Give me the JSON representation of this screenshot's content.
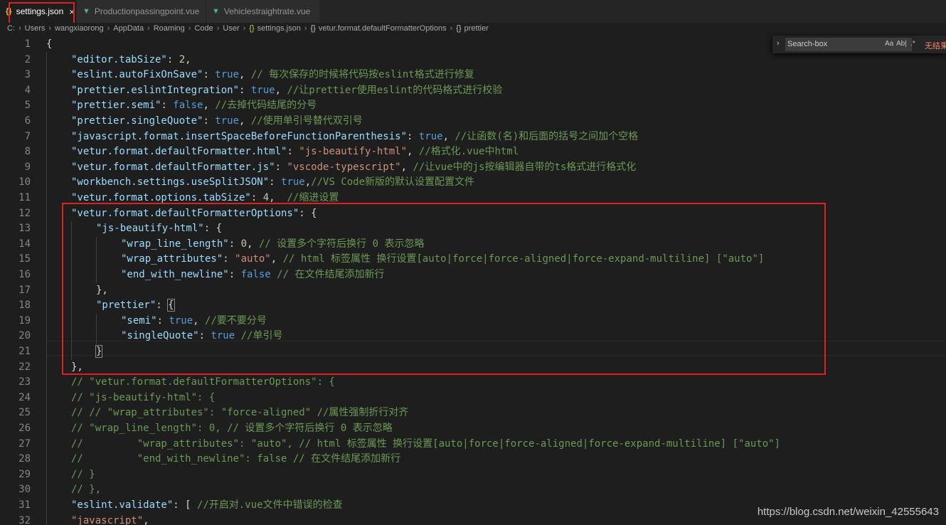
{
  "tabs": [
    {
      "label": "settings.json",
      "icon": "{}",
      "active": true,
      "close": "×"
    },
    {
      "label": "Productionpassingpoint.vue",
      "icon": "▼",
      "active": false
    },
    {
      "label": "Vehiclestraightrate.vue",
      "icon": "▼",
      "active": false
    }
  ],
  "breadcrumb": [
    "C:",
    "Users",
    "wangxiaorong",
    "AppData",
    "Roaming",
    "Code",
    "User",
    "settings.json",
    "vetur.format.defaultFormatterOptions",
    "prettier"
  ],
  "find_widget": {
    "value": "Search-box",
    "match_case": "Aa",
    "whole_word": "Ab|",
    "regex": ".*",
    "no_results": "无结果"
  },
  "watermark": "https://blog.csdn.net/weixin_42555643",
  "lines": [
    {
      "n": "1",
      "indent": 0,
      "tokens": [
        [
          "p",
          "{"
        ]
      ]
    },
    {
      "n": "2",
      "indent": 1,
      "tokens": [
        [
          "k",
          "\"editor.tabSize\""
        ],
        [
          "p",
          ": "
        ],
        [
          "n",
          "2"
        ],
        [
          "p",
          ","
        ]
      ]
    },
    {
      "n": "3",
      "indent": 1,
      "tokens": [
        [
          "k",
          "\"eslint.autoFixOnSave\""
        ],
        [
          "p",
          ": "
        ],
        [
          "w",
          "true"
        ],
        [
          "p",
          ", "
        ],
        [
          "c",
          "// 每次保存的时候将代码按eslint格式进行修复"
        ]
      ]
    },
    {
      "n": "4",
      "indent": 1,
      "tokens": [
        [
          "k",
          "\"prettier.eslintIntegration\""
        ],
        [
          "p",
          ": "
        ],
        [
          "w",
          "true"
        ],
        [
          "p",
          ", "
        ],
        [
          "c",
          "//让prettier使用eslint的代码格式进行校验"
        ]
      ]
    },
    {
      "n": "5",
      "indent": 1,
      "tokens": [
        [
          "k",
          "\"prettier.semi\""
        ],
        [
          "p",
          ": "
        ],
        [
          "w",
          "false"
        ],
        [
          "p",
          ", "
        ],
        [
          "c",
          "//去掉代码结尾的分号"
        ]
      ]
    },
    {
      "n": "6",
      "indent": 1,
      "tokens": [
        [
          "k",
          "\"prettier.singleQuote\""
        ],
        [
          "p",
          ": "
        ],
        [
          "w",
          "true"
        ],
        [
          "p",
          ", "
        ],
        [
          "c",
          "//使用单引号替代双引号"
        ]
      ]
    },
    {
      "n": "7",
      "indent": 1,
      "tokens": [
        [
          "k",
          "\"javascript.format.insertSpaceBeforeFunctionParenthesis\""
        ],
        [
          "p",
          ": "
        ],
        [
          "w",
          "true"
        ],
        [
          "p",
          ", "
        ],
        [
          "c",
          "//让函数(名)和后面的括号之间加个空格"
        ]
      ]
    },
    {
      "n": "8",
      "indent": 1,
      "tokens": [
        [
          "k",
          "\"vetur.format.defaultFormatter.html\""
        ],
        [
          "p",
          ": "
        ],
        [
          "s",
          "\"js-beautify-html\""
        ],
        [
          "p",
          ", "
        ],
        [
          "c",
          "//格式化.vue中html"
        ]
      ]
    },
    {
      "n": "9",
      "indent": 1,
      "tokens": [
        [
          "k",
          "\"vetur.format.defaultFormatter.js\""
        ],
        [
          "p",
          ": "
        ],
        [
          "s",
          "\"vscode-typescript\""
        ],
        [
          "p",
          ", "
        ],
        [
          "c",
          "//让vue中的js按编辑器自带的ts格式进行格式化"
        ]
      ]
    },
    {
      "n": "10",
      "indent": 1,
      "tokens": [
        [
          "k",
          "\"workbench.settings.useSplitJSON\""
        ],
        [
          "p",
          ": "
        ],
        [
          "w",
          "true"
        ],
        [
          "p",
          ","
        ],
        [
          "c",
          "//VS Code新版的默认设置配置文件"
        ]
      ]
    },
    {
      "n": "11",
      "indent": 1,
      "tokens": [
        [
          "k",
          "\"vetur.format.options.tabSize\""
        ],
        [
          "p",
          ": "
        ],
        [
          "n",
          "4"
        ],
        [
          "p",
          ",  "
        ],
        [
          "c",
          "//缩进设置"
        ]
      ]
    },
    {
      "n": "12",
      "indent": 1,
      "tokens": [
        [
          "k",
          "\"vetur.format.defaultFormatterOptions\""
        ],
        [
          "p",
          ": {"
        ]
      ]
    },
    {
      "n": "13",
      "indent": 2,
      "tokens": [
        [
          "k",
          "\"js-beautify-html\""
        ],
        [
          "p",
          ": {"
        ]
      ]
    },
    {
      "n": "14",
      "indent": 3,
      "tokens": [
        [
          "k",
          "\"wrap_line_length\""
        ],
        [
          "p",
          ": "
        ],
        [
          "n",
          "0"
        ],
        [
          "p",
          ", "
        ],
        [
          "c",
          "// 设置多个字符后换行 0 表示忽略"
        ]
      ]
    },
    {
      "n": "15",
      "indent": 3,
      "tokens": [
        [
          "k",
          "\"wrap_attributes\""
        ],
        [
          "p",
          ": "
        ],
        [
          "s",
          "\"auto\""
        ],
        [
          "p",
          ", "
        ],
        [
          "c",
          "// html 标签属性 换行设置[auto|force|force-aligned|force-expand-multiline] [\"auto\"]"
        ]
      ]
    },
    {
      "n": "16",
      "indent": 3,
      "tokens": [
        [
          "k",
          "\"end_with_newline\""
        ],
        [
          "p",
          ": "
        ],
        [
          "w",
          "false"
        ],
        [
          "p",
          " "
        ],
        [
          "c",
          "// 在文件结尾添加新行"
        ]
      ]
    },
    {
      "n": "17",
      "indent": 2,
      "tokens": [
        [
          "p",
          "},"
        ]
      ]
    },
    {
      "n": "18",
      "indent": 2,
      "tokens": [
        [
          "k",
          "\"prettier\""
        ],
        [
          "p",
          ": "
        ],
        [
          "h",
          "{"
        ]
      ]
    },
    {
      "n": "19",
      "indent": 3,
      "tokens": [
        [
          "k",
          "\"semi\""
        ],
        [
          "p",
          ": "
        ],
        [
          "w",
          "true"
        ],
        [
          "p",
          ", "
        ],
        [
          "c",
          "//要不要分号"
        ]
      ]
    },
    {
      "n": "20",
      "indent": 3,
      "tokens": [
        [
          "k",
          "\"singleQuote\""
        ],
        [
          "p",
          ": "
        ],
        [
          "w",
          "true"
        ],
        [
          "p",
          " "
        ],
        [
          "c",
          "//单引号"
        ]
      ]
    },
    {
      "n": "21",
      "indent": 2,
      "tokens": [
        [
          "h",
          "}"
        ]
      ]
    },
    {
      "n": "22",
      "indent": 1,
      "tokens": [
        [
          "p",
          "},"
        ]
      ]
    },
    {
      "n": "23",
      "indent": 1,
      "tokens": [
        [
          "c",
          "// \"vetur.format.defaultFormatterOptions\": {"
        ]
      ]
    },
    {
      "n": "24",
      "indent": 1,
      "tokens": [
        [
          "c",
          "// \"js-beautify-html\": {"
        ]
      ]
    },
    {
      "n": "25",
      "indent": 1,
      "tokens": [
        [
          "c",
          "// // \"wrap_attributes\": \"force-aligned\" //属性强制折行对齐"
        ]
      ]
    },
    {
      "n": "26",
      "indent": 1,
      "tokens": [
        [
          "c",
          "// \"wrap_line_length\": 0, // 设置多个字符后换行 0 表示忽略"
        ]
      ]
    },
    {
      "n": "27",
      "indent": 1,
      "tokens": [
        [
          "c",
          "//         \"wrap_attributes\": \"auto\", // html 标签属性 换行设置[auto|force|force-aligned|force-expand-multiline] [\"auto\"]"
        ]
      ]
    },
    {
      "n": "28",
      "indent": 1,
      "tokens": [
        [
          "c",
          "//         \"end_with_newline\": false // 在文件结尾添加新行"
        ]
      ]
    },
    {
      "n": "29",
      "indent": 1,
      "tokens": [
        [
          "c",
          "// }"
        ]
      ]
    },
    {
      "n": "30",
      "indent": 1,
      "tokens": [
        [
          "c",
          "// },"
        ]
      ]
    },
    {
      "n": "31",
      "indent": 1,
      "tokens": [
        [
          "k",
          "\"eslint.validate\""
        ],
        [
          "p",
          ": [ "
        ],
        [
          "c",
          "//开启对.vue文件中错误的检查"
        ]
      ]
    },
    {
      "n": "32",
      "indent": 1,
      "tokens": [
        [
          "s",
          "\"javascript\""
        ],
        [
          "p",
          ","
        ]
      ]
    }
  ]
}
